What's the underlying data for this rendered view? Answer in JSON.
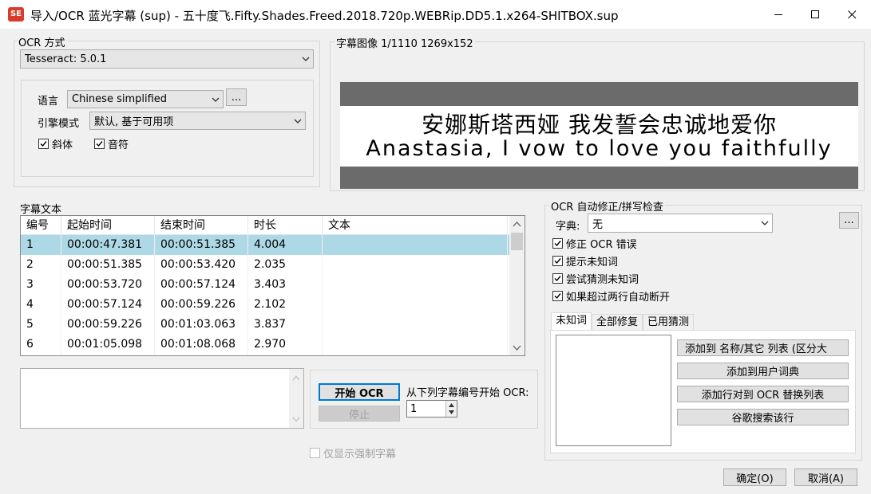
{
  "window": {
    "title": "导入/OCR 蓝光字幕 (sup) - 五十度飞.Fifty.Shades.Freed.2018.720p.WEBRip.DD5.1.x264-SHITBOX.sup",
    "icon_text": "SE"
  },
  "ocr_method": {
    "legend": "OCR 方式",
    "engine": "Tesseract: 5.0.1",
    "language_label": "语言",
    "language": "Chinese simplified",
    "browse_label": "...",
    "engine_mode_label": "引擎模式",
    "engine_mode": "默认, 基于可用项",
    "italic_label": "斜体",
    "italic_checked": true,
    "music_label": "音符",
    "music_checked": true
  },
  "subtitle_image": {
    "legend": "字幕图像 1/1110   1269x152",
    "line1": "安娜斯塔西娅 我发誓会忠诚地爱你",
    "line2": "Anastasia, I vow to love you faithfully"
  },
  "subtitle_text": {
    "legend": "字幕文本",
    "columns": [
      "编号",
      "起始时间",
      "结束时间",
      "时长",
      "文本"
    ],
    "rows": [
      {
        "num": "1",
        "start": "00:00:47.381",
        "end": "00:00:51.385",
        "duration": "4.004",
        "text": ""
      },
      {
        "num": "2",
        "start": "00:00:51.385",
        "end": "00:00:53.420",
        "duration": "2.035",
        "text": ""
      },
      {
        "num": "3",
        "start": "00:00:53.720",
        "end": "00:00:57.124",
        "duration": "3.403",
        "text": ""
      },
      {
        "num": "4",
        "start": "00:00:57.124",
        "end": "00:00:59.226",
        "duration": "2.102",
        "text": ""
      },
      {
        "num": "5",
        "start": "00:00:59.226",
        "end": "00:01:03.063",
        "duration": "3.837",
        "text": ""
      },
      {
        "num": "6",
        "start": "00:01:05.098",
        "end": "00:01:08.068",
        "duration": "2.970",
        "text": ""
      }
    ],
    "selected_row": 0
  },
  "ocr_controls": {
    "start_label": "开始 OCR",
    "stop_label": "停止",
    "start_from_label": "从下列字幕编号开始 OCR:",
    "start_from_value": "1",
    "forced_only_label": "仅显示强制字幕"
  },
  "autocorrect": {
    "legend": "OCR 自动修正/拼写检查",
    "dictionary_label": "字典:",
    "dictionary": "无",
    "browse_label": "...",
    "options": [
      {
        "label": "修正 OCR 错误",
        "checked": true
      },
      {
        "label": "提示未知词",
        "checked": true
      },
      {
        "label": "尝试猜测未知词",
        "checked": true
      },
      {
        "label": "如果超过两行自动断开",
        "checked": true
      }
    ],
    "tabs": [
      "未知词",
      "全部修复",
      "已用猜测"
    ],
    "active_tab": 0,
    "buttons": [
      "添加到 名称/其它 列表 (区分大",
      "添加到用户词典",
      "添加行对到 OCR 替换列表",
      "谷歌搜索该行"
    ]
  },
  "footer": {
    "ok_label": "确定(O)",
    "cancel_label": "取消(A)"
  }
}
